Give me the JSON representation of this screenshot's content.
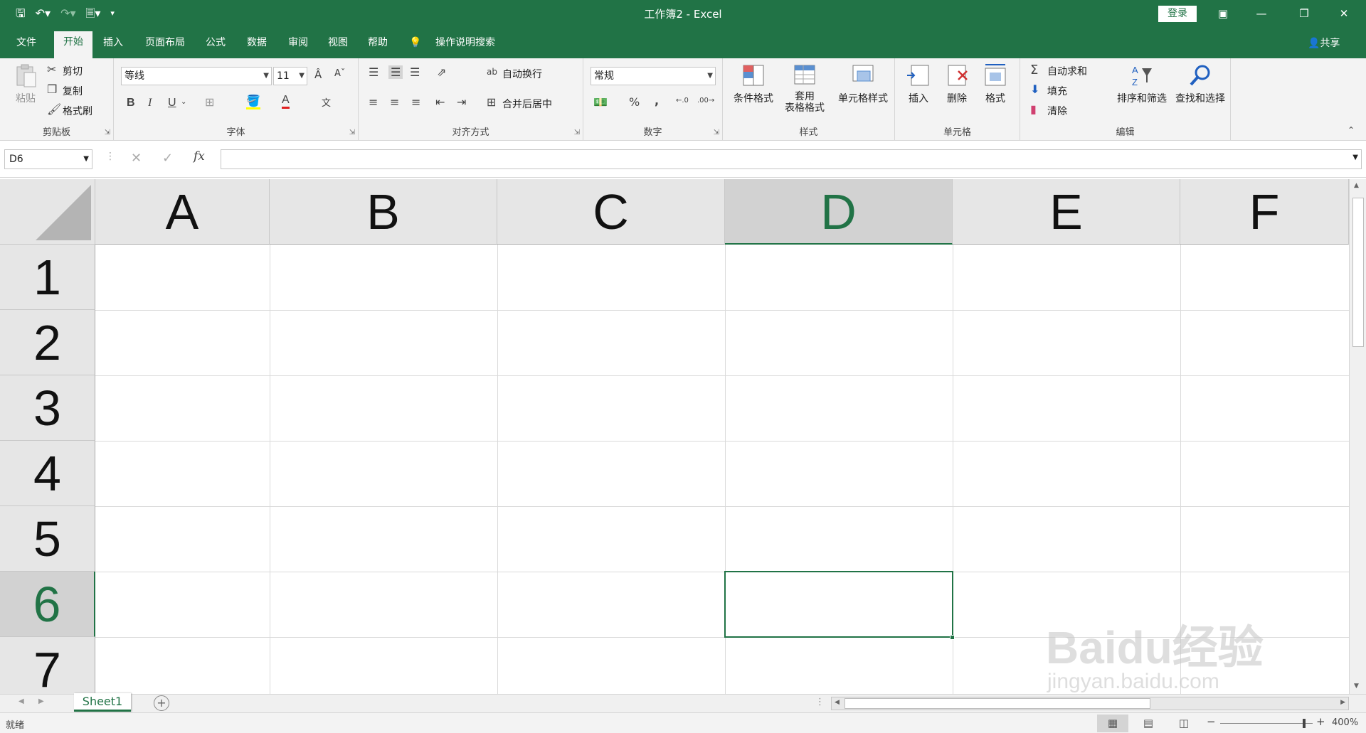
{
  "app": {
    "title": "工作簿2 - Excel",
    "login": "登录",
    "share": "共享",
    "accent": "#217346"
  },
  "qat": [
    "save-icon",
    "undo-icon",
    "redo-icon",
    "print-preview-icon",
    "customize-icon"
  ],
  "window_buttons": [
    "ribbon-display-icon",
    "minimize-icon",
    "restore-icon",
    "close-icon"
  ],
  "tabs": [
    {
      "label": "文件"
    },
    {
      "label": "开始"
    },
    {
      "label": "插入"
    },
    {
      "label": "页面布局"
    },
    {
      "label": "公式"
    },
    {
      "label": "数据"
    },
    {
      "label": "审阅"
    },
    {
      "label": "视图"
    },
    {
      "label": "帮助"
    },
    {
      "label": "操作说明搜索"
    }
  ],
  "ribbon": {
    "clipboard": {
      "label": "剪贴板",
      "paste": "粘贴",
      "cut": "剪切",
      "copy": "复制",
      "format_painter": "格式刷"
    },
    "font": {
      "label": "字体",
      "font_name": "等线",
      "font_size": "11",
      "bold": "B",
      "italic": "I",
      "underline": "U"
    },
    "alignment": {
      "label": "对齐方式",
      "wrap": "自动换行",
      "merge": "合并后居中"
    },
    "number": {
      "label": "数字",
      "format": "常规",
      "percent": "%",
      "comma": ","
    },
    "styles": {
      "label": "样式",
      "conditional": "条件格式",
      "table_line1": "套用",
      "table_line2": "表格格式",
      "cell_styles": "单元格样式"
    },
    "cells": {
      "label": "单元格",
      "insert": "插入",
      "delete": "删除",
      "format": "格式"
    },
    "editing": {
      "label": "编辑",
      "autosum": "自动求和",
      "fill": "填充",
      "clear": "清除",
      "sort": "排序和筛选",
      "find": "查找和选择"
    }
  },
  "formula_bar": {
    "name_box": "D6",
    "fx": "fx",
    "value": ""
  },
  "sheet": {
    "columns": [
      "A",
      "B",
      "C",
      "D",
      "E",
      "F"
    ],
    "rows": [
      "1",
      "2",
      "3",
      "4",
      "5",
      "6",
      "7"
    ],
    "selected_col": "D",
    "selected_row": "6"
  },
  "sheet_tabs": [
    {
      "name": "Sheet1",
      "active": true
    }
  ],
  "status": {
    "ready": "就绪",
    "zoom": "400%"
  },
  "watermark": {
    "logo": "Baidu经验",
    "url": "jingyan.baidu.com"
  }
}
